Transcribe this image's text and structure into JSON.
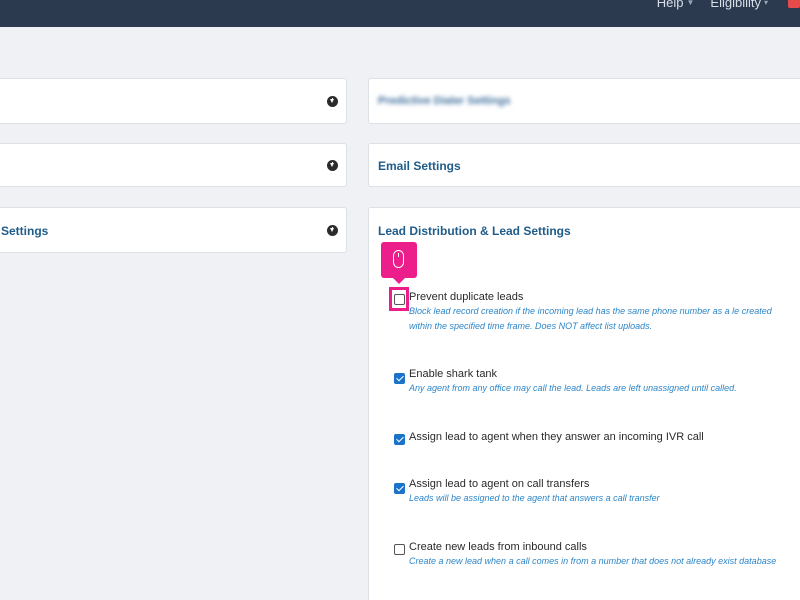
{
  "topnav": {
    "help_label": "Help",
    "eligibility_label": "Eligibility"
  },
  "left_panels": [
    {
      "title": ""
    },
    {
      "title": ""
    },
    {
      "title": "Settings"
    }
  ],
  "right_panels": {
    "blurred_title": "Predictive Dialer Settings",
    "email_title": "Email Settings",
    "lead_title": "Lead Distribution & Lead Settings"
  },
  "settings": [
    {
      "label": "Prevent duplicate leads",
      "checked": false,
      "description": "Block lead record creation if the incoming lead has the same phone number as a le created within the specified time frame. Does NOT affect list uploads."
    },
    {
      "label": "Enable shark tank",
      "checked": true,
      "description": "Any agent from any office may call the lead. Leads are left unassigned until called."
    },
    {
      "label": "Assign lead to agent when they answer an incoming IVR call",
      "checked": true,
      "description": ""
    },
    {
      "label": "Assign lead to agent on call transfers",
      "checked": true,
      "description": "Leads will be assigned to the agent that answers a call transfer"
    },
    {
      "label": "Create new leads from inbound calls",
      "checked": false,
      "description": "Create a new lead when a call comes in from a number that does not already exist database"
    }
  ],
  "colors": {
    "topbar": "#2c3a4f",
    "title_blue": "#1f5c8a",
    "desc_blue": "#2d86c8",
    "checkbox_blue": "#1a73c9",
    "highlight_pink": "#ec1e8c"
  },
  "icons": {
    "expand": "arrow-circle-down-icon",
    "cursor": "mouse-icon"
  }
}
